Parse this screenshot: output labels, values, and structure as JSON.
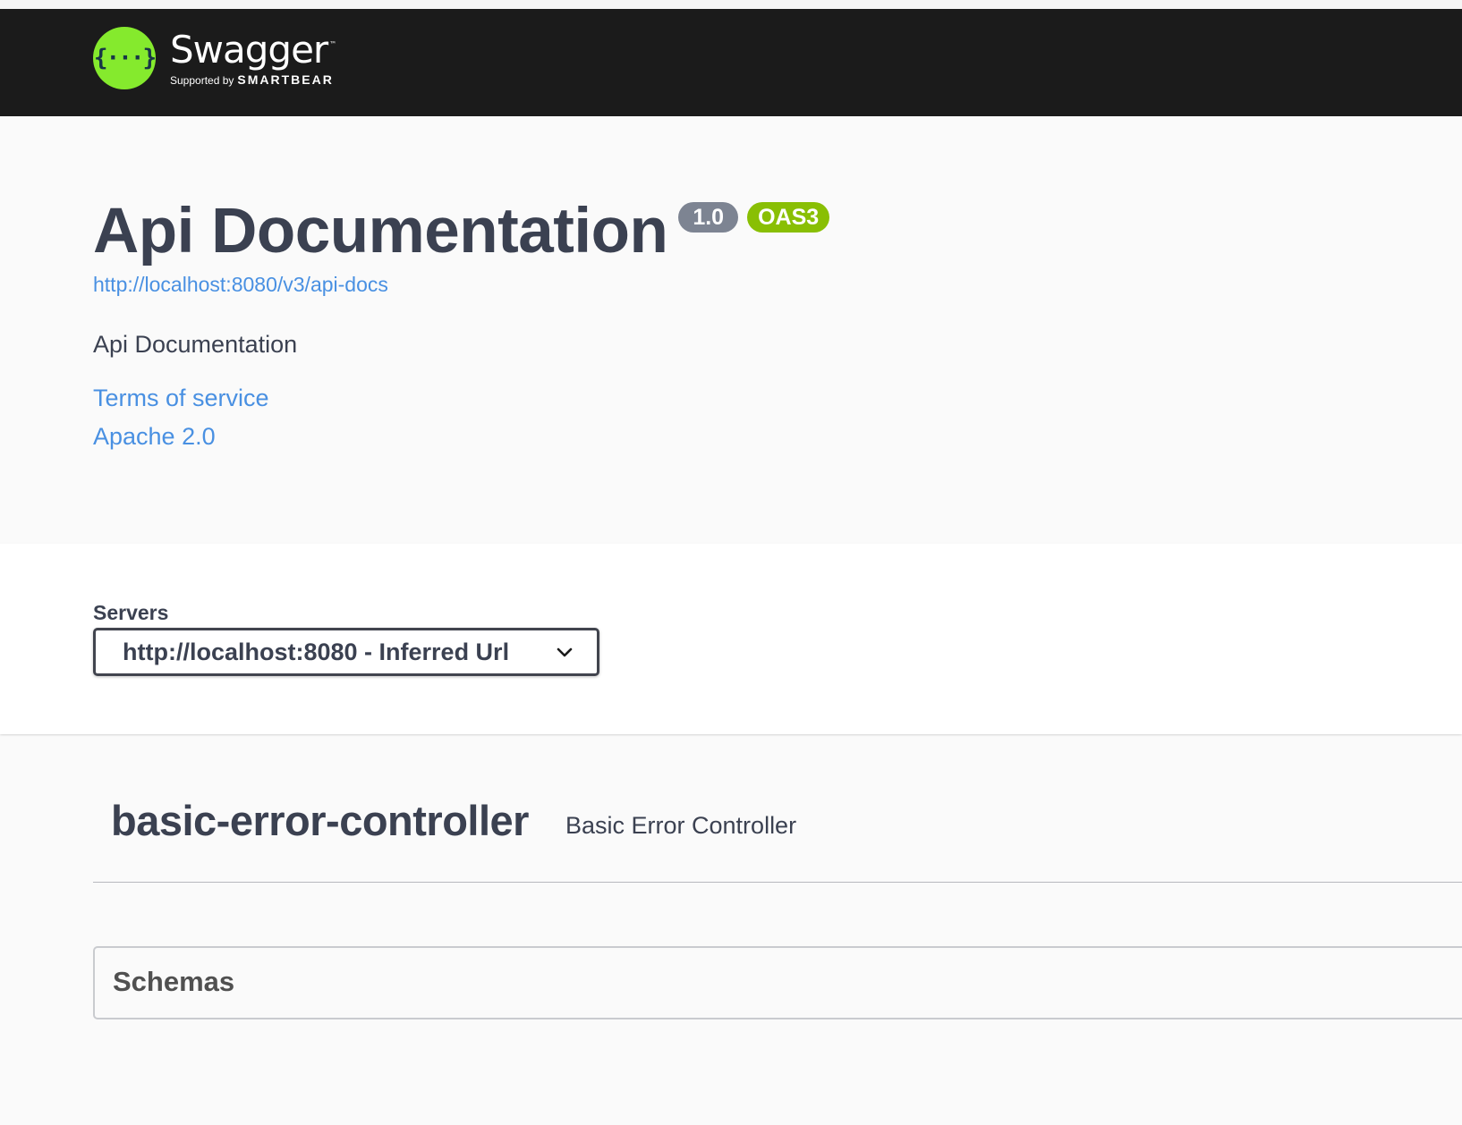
{
  "topbar": {
    "logo_icon": "{···}",
    "logo_name": "Swagger",
    "logo_tm": "™",
    "supported_by": "Supported by",
    "brand": "SMARTBEAR"
  },
  "info": {
    "title": "Api Documentation",
    "version_badge": "1.0",
    "oas_badge": "OAS3",
    "spec_url": "http://localhost:8080/v3/api-docs",
    "description": "Api Documentation",
    "terms_link": "Terms of service",
    "license_link": "Apache 2.0"
  },
  "servers": {
    "label": "Servers",
    "selected": "http://localhost:8080 - Inferred Url"
  },
  "tags": [
    {
      "name": "basic-error-controller",
      "description": "Basic Error Controller"
    }
  ],
  "schemas": {
    "title": "Schemas"
  },
  "colors": {
    "topbar_bg": "#1b1b1b",
    "logo_green": "#85ea2d",
    "link_blue": "#4990e2",
    "version_badge_bg": "#7d8492",
    "oas_badge_bg": "#89bf04",
    "text_dark": "#3b4151"
  },
  "icons": {
    "logo": "swagger-logo-icon",
    "dropdown": "chevron-down-icon"
  }
}
